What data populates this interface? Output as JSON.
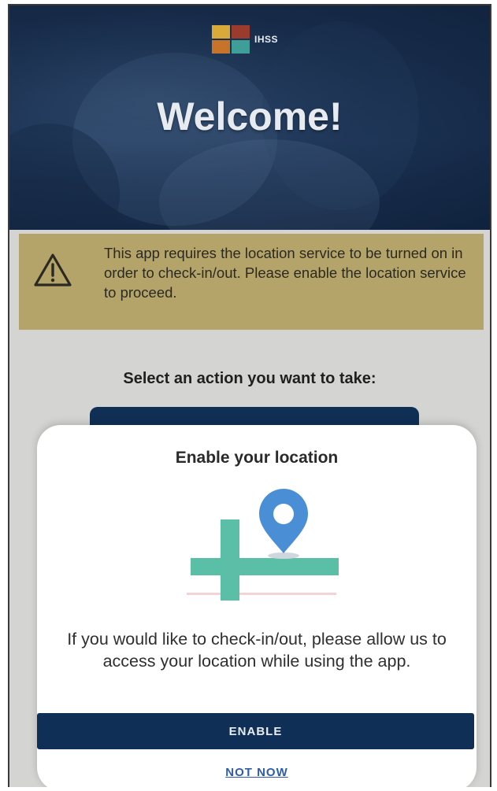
{
  "header": {
    "logo_text": "IHSS",
    "welcome_title": "Welcome!"
  },
  "warning": {
    "icon": "warning-triangle-icon",
    "message": "This app requires the location service to be turned on in order to check-in/out. Please enable the location service to proceed."
  },
  "actions": {
    "prompt": "Select an action you want to take:"
  },
  "modal": {
    "title": "Enable your location",
    "illustration_icon": "map-pin-icon",
    "body": "If you would like to check-in/out, please allow us to access your location while using the app.",
    "enable_label": "ENABLE",
    "not_now_label": "NOT NOW"
  },
  "colors": {
    "header_bg": "#1e3a60",
    "warning_bg": "#b5a46a",
    "primary_button": "#0f2f57",
    "link": "#2d5ca8",
    "pin": "#4a8fd6",
    "road": "#5bbfa8"
  }
}
